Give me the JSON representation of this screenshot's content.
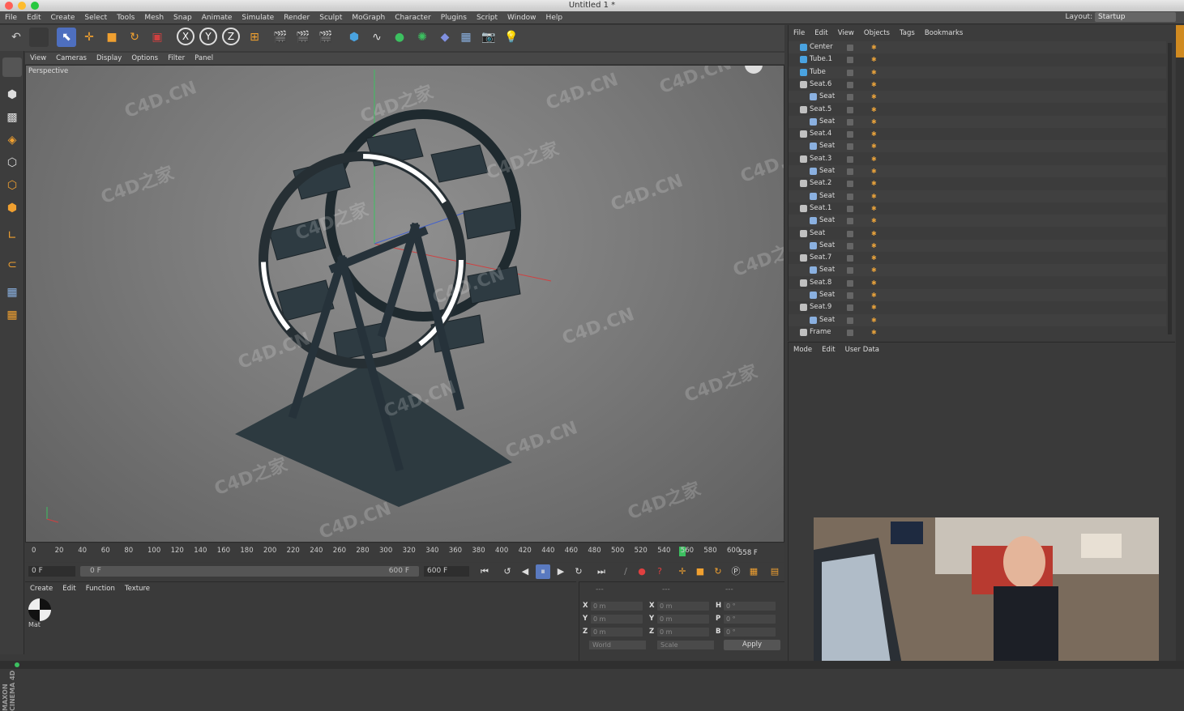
{
  "window": {
    "title": "Untitled 1 *"
  },
  "menubar": {
    "items": [
      "File",
      "Edit",
      "Create",
      "Select",
      "Tools",
      "Mesh",
      "Snap",
      "Animate",
      "Simulate",
      "Render",
      "Sculpt",
      "MoGraph",
      "Character",
      "Plugins",
      "Script",
      "Window",
      "Help"
    ],
    "layout_label": "Layout:",
    "layout_value": "Startup"
  },
  "toolbar": {
    "axis_x": "X",
    "axis_y": "Y",
    "axis_z": "Z"
  },
  "viewport": {
    "menu": [
      "View",
      "Cameras",
      "Display",
      "Options",
      "Filter",
      "Panel"
    ],
    "label": "Perspective",
    "watermarks": [
      "C4D.CN",
      "C4D之家",
      "C4D.CN",
      "C4D之家",
      "C4D.CN",
      "C4D之家",
      "C4D.CN",
      "C4D之家",
      "C4D.CN",
      "C4D.CN",
      "C4D之家",
      "C4D.CN",
      "C4D之家",
      "C4D.CN",
      "C4D.CN",
      "C4D之家",
      "C4D.CN",
      "C4D.CN",
      "C4D之家",
      "C4D.CN"
    ]
  },
  "timeline": {
    "ticks": [
      "0",
      "20",
      "40",
      "60",
      "80",
      "100",
      "120",
      "140",
      "160",
      "180",
      "200",
      "220",
      "240",
      "260",
      "280",
      "300",
      "320",
      "340",
      "360",
      "380",
      "400",
      "420",
      "440",
      "460",
      "480",
      "500",
      "520",
      "540",
      "560",
      "580",
      "600"
    ],
    "current_frame_display": "558 F"
  },
  "transport": {
    "start_field": "0 F",
    "range_start": "0 F",
    "range_end": "600 F",
    "end_field": "600 F"
  },
  "material_manager": {
    "menu": [
      "Create",
      "Edit",
      "Function",
      "Texture"
    ],
    "material_name": "Mat"
  },
  "coordinates": {
    "header_left": "---",
    "header_mid": "---",
    "header_right": "---",
    "rows": [
      {
        "a": "X",
        "a_val": "0 m",
        "b": "X",
        "b_val": "0 m",
        "c": "H",
        "c_val": "0 °"
      },
      {
        "a": "Y",
        "a_val": "0 m",
        "b": "Y",
        "b_val": "0 m",
        "c": "P",
        "c_val": "0 °"
      },
      {
        "a": "Z",
        "a_val": "0 m",
        "b": "Z",
        "b_val": "0 m",
        "c": "B",
        "c_val": "0 °"
      }
    ],
    "mode": "World",
    "scale": "Scale",
    "apply": "Apply"
  },
  "object_manager": {
    "menu": [
      "File",
      "Edit",
      "View",
      "Objects",
      "Tags",
      "Bookmarks"
    ],
    "objects": [
      {
        "name": "Center",
        "indent": 0,
        "type": "prim"
      },
      {
        "name": "Tube.1",
        "indent": 0,
        "type": "prim"
      },
      {
        "name": "Tube",
        "indent": 0,
        "type": "prim"
      },
      {
        "name": "Seat.6",
        "indent": 0,
        "type": "null"
      },
      {
        "name": "Seat",
        "indent": 1,
        "type": "bone"
      },
      {
        "name": "Seat.5",
        "indent": 0,
        "type": "null"
      },
      {
        "name": "Seat",
        "indent": 1,
        "type": "bone"
      },
      {
        "name": "Seat.4",
        "indent": 0,
        "type": "null"
      },
      {
        "name": "Seat",
        "indent": 1,
        "type": "bone"
      },
      {
        "name": "Seat.3",
        "indent": 0,
        "type": "null"
      },
      {
        "name": "Seat",
        "indent": 1,
        "type": "bone"
      },
      {
        "name": "Seat.2",
        "indent": 0,
        "type": "null"
      },
      {
        "name": "Seat",
        "indent": 1,
        "type": "bone"
      },
      {
        "name": "Seat.1",
        "indent": 0,
        "type": "null"
      },
      {
        "name": "Seat",
        "indent": 1,
        "type": "bone"
      },
      {
        "name": "Seat",
        "indent": 0,
        "type": "null"
      },
      {
        "name": "Seat",
        "indent": 1,
        "type": "bone"
      },
      {
        "name": "Seat.7",
        "indent": 0,
        "type": "null"
      },
      {
        "name": "Seat",
        "indent": 1,
        "type": "bone"
      },
      {
        "name": "Seat.8",
        "indent": 0,
        "type": "null"
      },
      {
        "name": "Seat",
        "indent": 1,
        "type": "bone"
      },
      {
        "name": "Seat.9",
        "indent": 0,
        "type": "null"
      },
      {
        "name": "Seat",
        "indent": 1,
        "type": "bone"
      },
      {
        "name": "Frame",
        "indent": 0,
        "type": "null"
      }
    ]
  },
  "attribute_manager": {
    "menu": [
      "Mode",
      "Edit",
      "User Data"
    ]
  },
  "branding": {
    "logo_text": "MAXON CINEMA 4D"
  },
  "colors": {
    "accent": "#f0a030",
    "bg": "#3a3a3a",
    "panel": "#454545"
  }
}
